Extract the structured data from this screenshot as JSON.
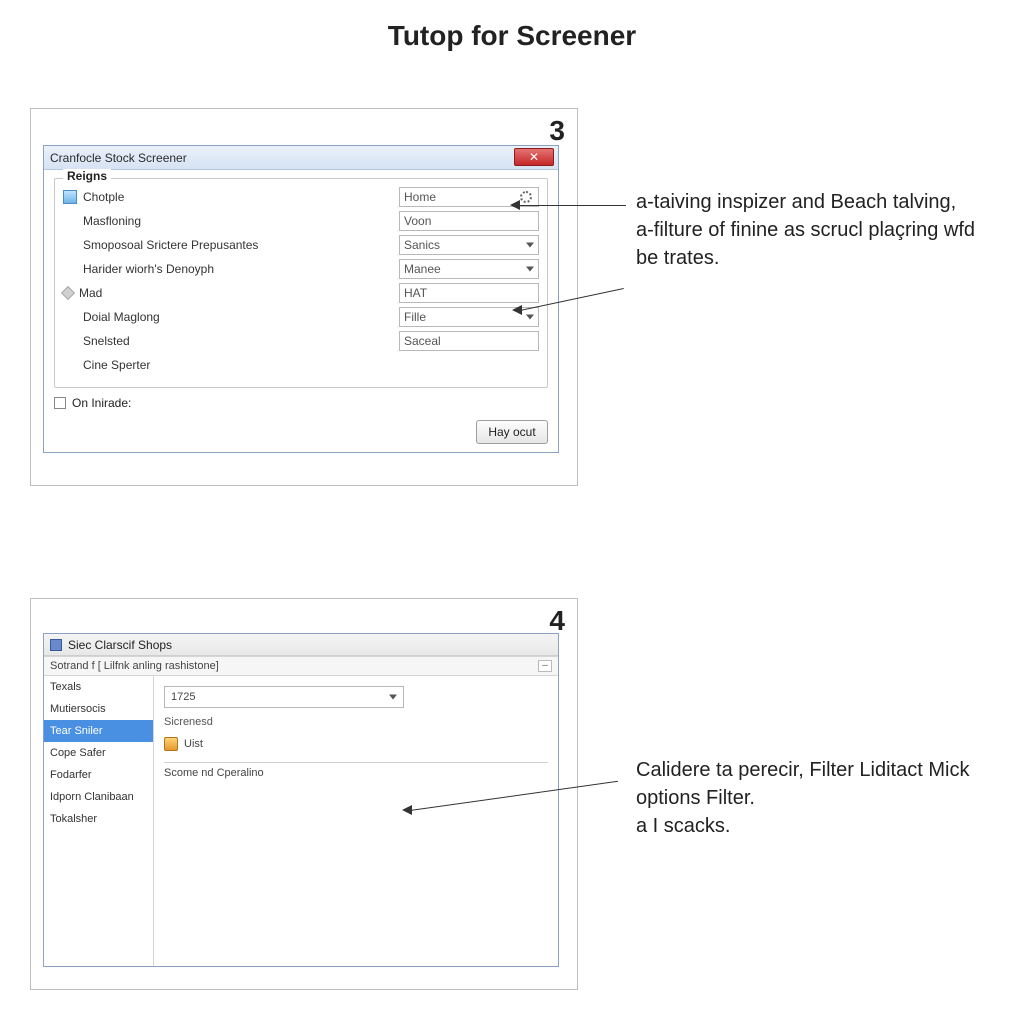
{
  "title": "Tutop for Screener",
  "step3": {
    "number": "3",
    "dialog_title": "Cranfocle Stock Screener",
    "group_title": "Reigns",
    "rows": [
      {
        "icon": "doc-icon",
        "label": "Chotple",
        "value": "Home",
        "type": "gear"
      },
      {
        "icon": "",
        "label": "Masfloning",
        "value": "Voon",
        "type": "text"
      },
      {
        "icon": "",
        "label": "Smoposoal Srictere Prepusantes",
        "value": "Sanics",
        "type": "dropdown"
      },
      {
        "icon": "",
        "label": "Harider wiorh's Denoyph",
        "value": "Manee",
        "type": "dropdown"
      },
      {
        "icon": "diamond-icon",
        "label": "Mad",
        "value": "HAT",
        "type": "text"
      },
      {
        "icon": "",
        "label": "Doial Maglong",
        "value": "Fille",
        "type": "dropdown"
      },
      {
        "icon": "",
        "label": "Snelsted",
        "value": "Saceal",
        "type": "text"
      },
      {
        "icon": "",
        "label": "Cine Sperter",
        "value": "",
        "type": "none"
      }
    ],
    "checkbox_label": "On Inirade:",
    "button_label": "Hay ocut",
    "annotation": "a-taiving inspizer and Beach talving, a-filture of finine as scrucl plaçring wfd be trates."
  },
  "step4": {
    "number": "4",
    "window_title": "Siec Clarscif Shops",
    "section_title": "Sotrand f [ Lilfnk anling rashistone]",
    "sidebar": [
      "Texals",
      "Mutiersocis",
      "Tear Sniler",
      "Cope Safer",
      "Fodarfer",
      "Idporn Clanibaan",
      "Tokalsher"
    ],
    "selected_index": 2,
    "combo_value": "1725",
    "sub_label": "Sicrenesd",
    "list_item": "Uist",
    "lower_section": "Scome nd Cperalino",
    "annotation": "Calidere ta perecir, Filter Liditact Mick options Filter.\na I scacks."
  }
}
